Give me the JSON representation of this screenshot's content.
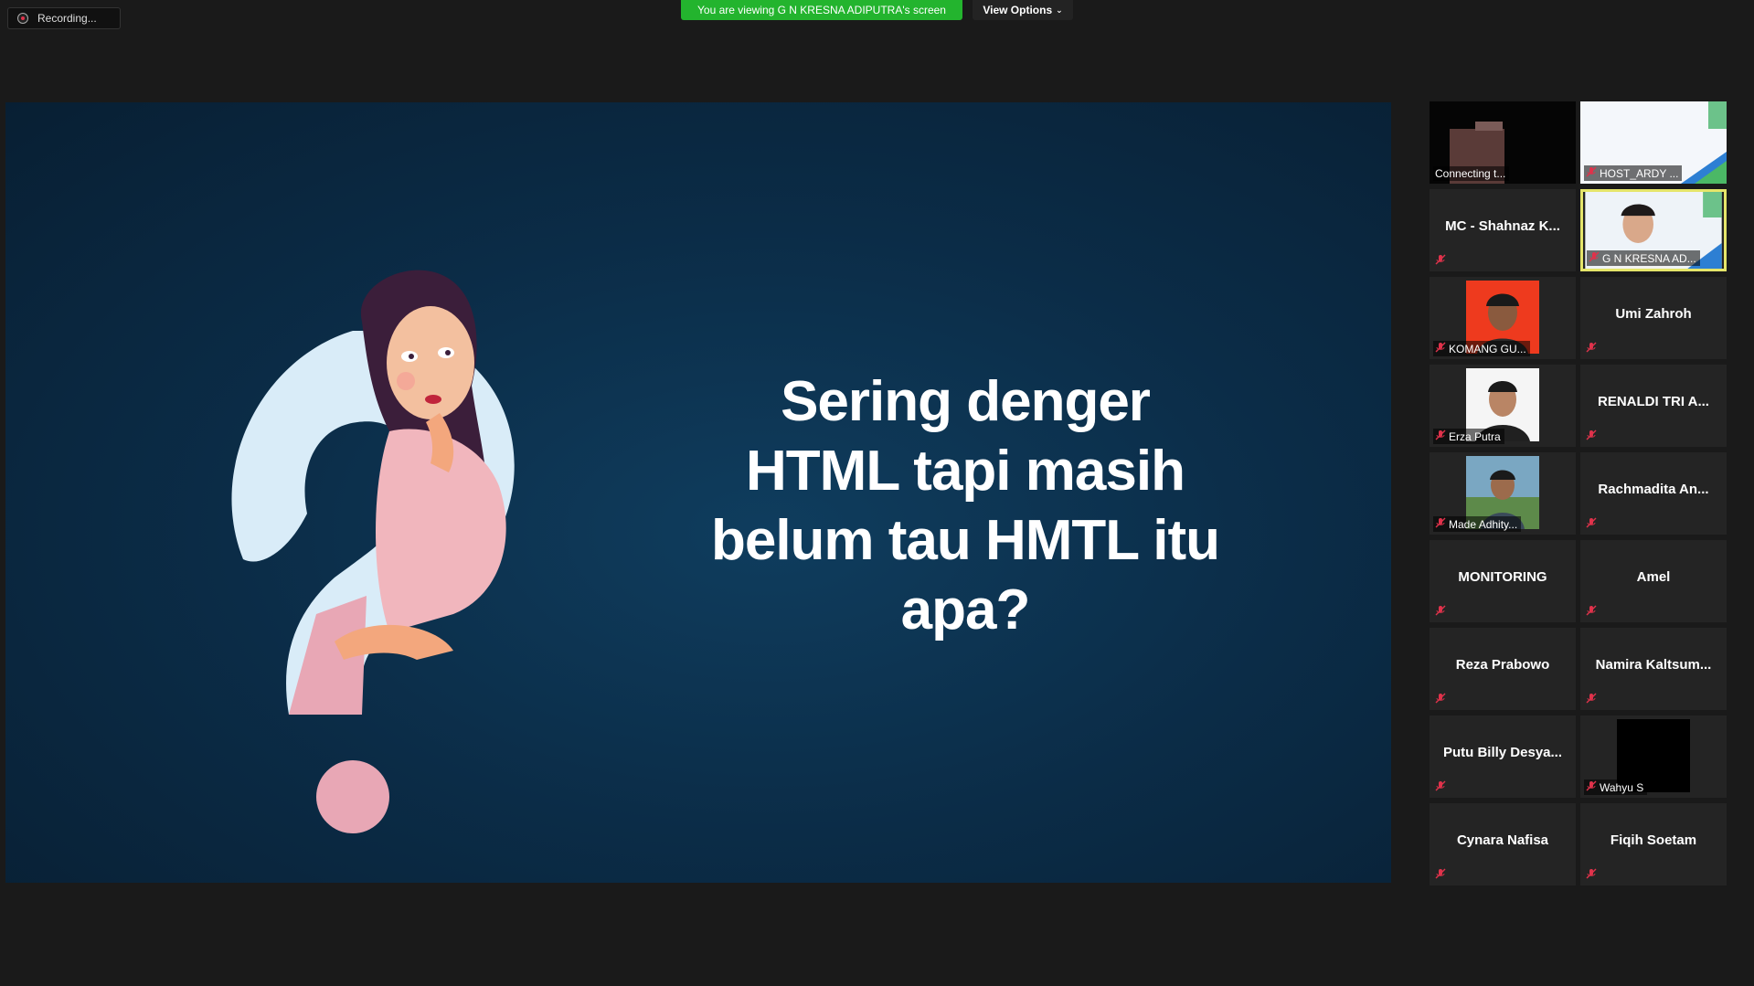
{
  "recording": {
    "label": "Recording..."
  },
  "banner": {
    "viewing": "You are viewing G N KRESNA ADIPUTRA's screen",
    "view_options": "View Options"
  },
  "slide": {
    "lines": [
      "Sering denger",
      "HTML tapi masih",
      "belum tau HMTL itu",
      "apa?"
    ]
  },
  "gallery": {
    "tiles": [
      {
        "label": "Connecting t...",
        "type": "video-connecting"
      },
      {
        "label": "HOST_ARDY ...",
        "type": "video-slides"
      },
      {
        "name": "MC - Shahnaz K...",
        "type": "name"
      },
      {
        "label": "G N KRESNA AD...",
        "type": "video-person-active"
      },
      {
        "label": "KOMANG GU...",
        "type": "photo-red"
      },
      {
        "name": "Umi Zahroh",
        "type": "name"
      },
      {
        "label": "Erza Putra",
        "type": "photo-white"
      },
      {
        "name": "RENALDI TRI A...",
        "type": "name"
      },
      {
        "label": "Made Adhity...",
        "type": "photo-outdoor"
      },
      {
        "name": "Rachmadita An...",
        "type": "name"
      },
      {
        "name": "MONITORING",
        "type": "name"
      },
      {
        "name": "Amel",
        "type": "name"
      },
      {
        "name": "Reza Prabowo",
        "type": "name"
      },
      {
        "name": "Namira Kaltsum...",
        "type": "name"
      },
      {
        "name": "Putu Billy Desya...",
        "type": "name"
      },
      {
        "label": "Wahyu S",
        "type": "photo-black"
      },
      {
        "name": "Cynara Nafisa",
        "type": "name"
      },
      {
        "name": "Fiqih Soetam",
        "type": "name"
      }
    ]
  },
  "colors": {
    "green_banner": "#23b42e",
    "active_border": "#e5e56a",
    "mute_red": "#e0324b"
  }
}
